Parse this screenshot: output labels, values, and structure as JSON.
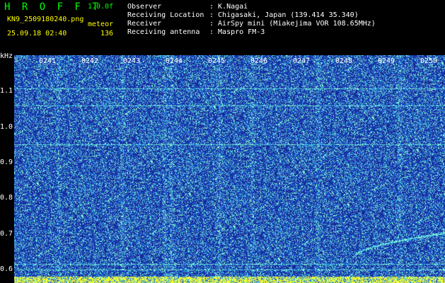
{
  "header": {
    "brand": "H R O F F T",
    "version": "1.0.0f",
    "filename": "KN9_2509180240.png",
    "mode": "meteor",
    "datetime": "25.09.18 02:40",
    "count": "136",
    "info": [
      {
        "label": "Observer",
        "value": ": K.Nagai"
      },
      {
        "label": "Receiving Location",
        "value": ": Chigasaki, Japan (139.414 35.340)"
      },
      {
        "label": "Receiver",
        "value": ": AirSpy mini (Miakejima VOR 108.65MHz)"
      },
      {
        "label": "Receiving antenna",
        "value": ": Maspro FM-3"
      }
    ]
  },
  "axis": {
    "y_unit": "kHz",
    "y_ticks": [
      "1.1",
      "1.0",
      "0.9",
      "0.8",
      "0.7",
      "0.6"
    ],
    "x_ticks": [
      "0241",
      "0242",
      "0243",
      "0244",
      "0245",
      "0246",
      "0247",
      "0248",
      "0249",
      "0250"
    ]
  },
  "colors": {
    "background": "#000000",
    "spectrogram_base": "#1a2fa8",
    "signal": "#7fffd0",
    "text_white": "#ffffff",
    "text_yellow": "#ffff00",
    "text_green": "#00ff00"
  }
}
